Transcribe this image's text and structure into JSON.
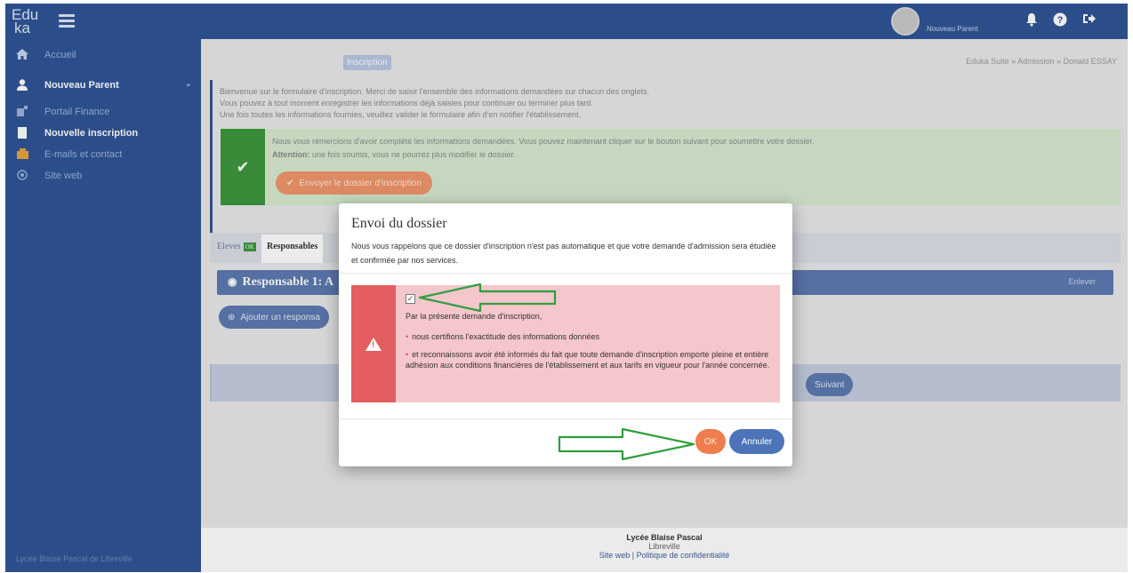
{
  "topbar": {
    "logo_line1": "Edu",
    "logo_line2": "ka",
    "user_name": "Nouveau Parent",
    "icons": [
      "bell-icon",
      "question-icon",
      "logout-icon"
    ]
  },
  "sidebar": {
    "items": [
      {
        "label": "Accueil",
        "icon": "home-icon"
      },
      {
        "label": "Nouveau Parent",
        "icon": "user-icon"
      },
      {
        "label": "Portail Finance",
        "icon": "finance-icon"
      },
      {
        "label": "Nouvelle inscription",
        "icon": "file-icon"
      },
      {
        "label": "E-mails et contact",
        "icon": "contact-icon"
      },
      {
        "label": "Site web",
        "icon": "globe-icon"
      }
    ],
    "footer": "Lycée Blaise Pascal de Libreville"
  },
  "main": {
    "page_tag": "Inscription",
    "breadcrumb": "Eduka Suite » Admission » Donald ESSAY",
    "info_lines": [
      "Bienvenue sur le formulaire d'inscription. Merci de saisir l'ensemble des informations demandées sur chacun des onglets.",
      "Vous pouvez à tout moment enregistrer les informations déjà saisies pour continuer ou terminer plus tard.",
      "Une fois toutes les informations fournies, veuillez valider le formulaire afin d'en notifier l'établissement."
    ],
    "success_line1": "Nous vous remercions d'avoir complété les informations demandées. Vous pouvez maintenant cliquer sur le bouton suivant pour soumettre votre dossier.",
    "success_attention_label": "Attention:",
    "success_line2": " une fois soumis, vous ne pourrez plus modifier le dossier.",
    "send_button": "Envoyer le dossier d'inscription",
    "tabs": [
      {
        "label": "Eleves",
        "badge": "OK"
      },
      {
        "label": "Responsables",
        "badge": ""
      }
    ],
    "responsable_title": "Responsable 1: A",
    "remove_label": "Enlever",
    "add_responsable": "Ajouter un responsa",
    "next_button": "Suivant"
  },
  "footer": {
    "school": "Lycée Blaise Pascal",
    "city": "Libreville",
    "links": "Site web | Politique de confidentialité"
  },
  "modal": {
    "title": "Envoi du dossier",
    "text": "Nous vous rappelons que ce dossier d'inscription n'est pas automatique et que votre demande d'admission sera étudiée et confirmée par nos services.",
    "checkbox_checked": true,
    "intro": "Par la présente demande d'inscription,",
    "items": [
      "nous certifions l'exactitude des informations données",
      "et reconnaissons avoir été informés du fait que toute demande d'inscription emporte pleine et entière adhésion aux conditions financières de l'établissement et aux tarifs en vigueur pour l'année concernée."
    ],
    "ok_label": "OK",
    "cancel_label": "Annuler",
    "annotation_color": "#2e9e3e"
  }
}
